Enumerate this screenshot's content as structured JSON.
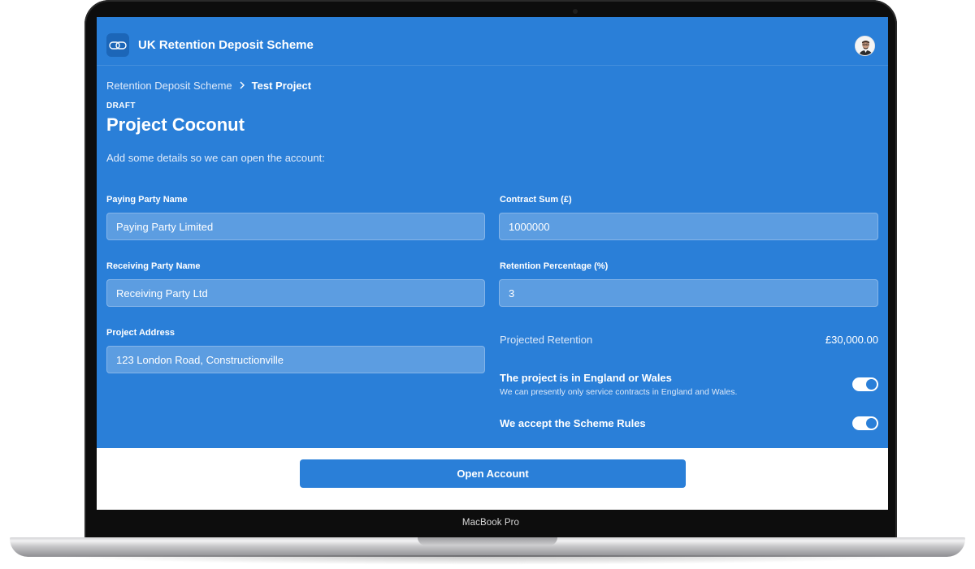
{
  "device": {
    "model_label": "MacBook Pro"
  },
  "header": {
    "app_title": "UK Retention Deposit Scheme",
    "logo_icon": "link-chain-icon",
    "avatar_icon": "user-avatar-icon"
  },
  "breadcrumb": {
    "items": [
      "Retention Deposit Scheme",
      "Test Project"
    ],
    "separator_icon": "chevron-right-icon"
  },
  "project": {
    "status": "DRAFT",
    "title": "Project Coconut",
    "intro": "Add some details so we can open the account:"
  },
  "form": {
    "paying_party": {
      "label": "Paying Party Name",
      "value": "Paying Party Limited"
    },
    "contract_sum": {
      "label": "Contract Sum (£)",
      "value": "1000000"
    },
    "receiving_party": {
      "label": "Receiving Party Name",
      "value": "Receiving Party Ltd"
    },
    "retention_percentage": {
      "label": "Retention Percentage (%)",
      "value": "3"
    },
    "project_address": {
      "label": "Project Address",
      "value": "123 London Road, Constructionville"
    }
  },
  "projected_retention": {
    "label": "Projected Retention",
    "value": "£30,000.00"
  },
  "toggles": {
    "england_wales": {
      "title": "The project is in England or Wales",
      "subtitle": "We can presently only service contracts in England and Wales.",
      "enabled": true
    },
    "scheme_rules": {
      "title": "We accept the Scheme Rules",
      "enabled": true
    }
  },
  "actions": {
    "open_account_label": "Open Account"
  },
  "colors": {
    "primary": "#2a7fd8",
    "logo_bg": "#1c66b8",
    "white": "#ffffff"
  }
}
